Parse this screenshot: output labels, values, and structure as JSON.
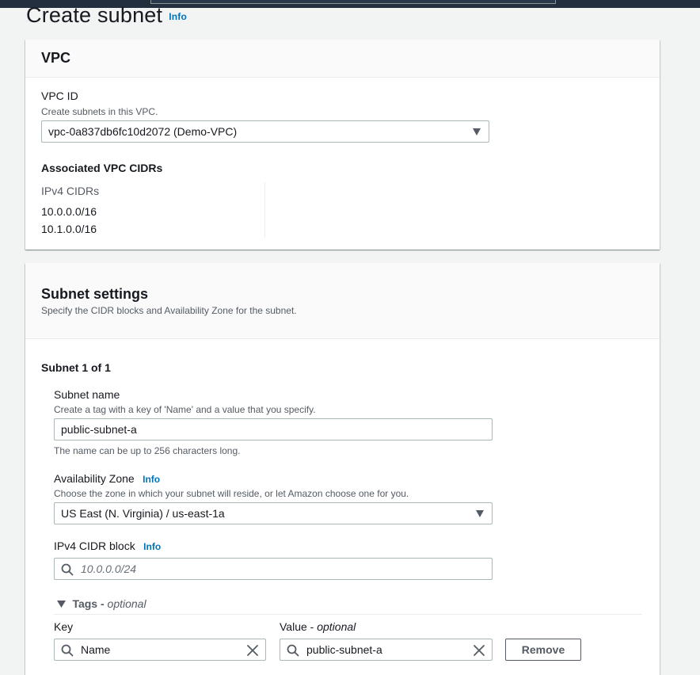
{
  "header": {
    "title": "Create subnet",
    "info": "Info"
  },
  "vpc_panel": {
    "title": "VPC",
    "vpc_id_label": "VPC ID",
    "vpc_id_desc": "Create subnets in this VPC.",
    "vpc_id_value": "vpc-0a837db6fc10d2072 (Demo-VPC)",
    "cidrs_title": "Associated VPC CIDRs",
    "cidrs_column": "IPv4 CIDRs",
    "cidrs": [
      "10.0.0.0/16",
      "10.1.0.0/16"
    ]
  },
  "subnet_panel": {
    "title": "Subnet settings",
    "desc": "Specify the CIDR blocks and Availability Zone for the subnet.",
    "subnet_heading": "Subnet 1 of 1",
    "name_label": "Subnet name",
    "name_desc": "Create a tag with a key of 'Name' and a value that you specify.",
    "name_value": "public-subnet-a",
    "name_hint": "The name can be up to 256 characters long.",
    "az_label": "Availability Zone",
    "az_info": "Info",
    "az_desc": "Choose the zone in which your subnet will reside, or let Amazon choose one for you.",
    "az_value": "US East (N. Virginia) / us-east-1a",
    "cidr_label": "IPv4 CIDR block",
    "cidr_info": "Info",
    "cidr_placeholder": "10.0.0.0/24",
    "tags_label": "Tags - ",
    "tags_optional": "optional",
    "key_label": "Key",
    "value_label": "Value - ",
    "value_optional": "optional",
    "tag_key": "Name",
    "tag_value": "public-subnet-a",
    "remove_label": "Remove"
  },
  "icons": {
    "dropdown": "caret-down-icon",
    "search": "search-icon",
    "clear": "close-icon",
    "expand": "triangle-down-icon"
  },
  "colors": {
    "link": "#0073bb",
    "text": "#16191f",
    "muted": "#545b64",
    "topbar": "#232f3e"
  }
}
